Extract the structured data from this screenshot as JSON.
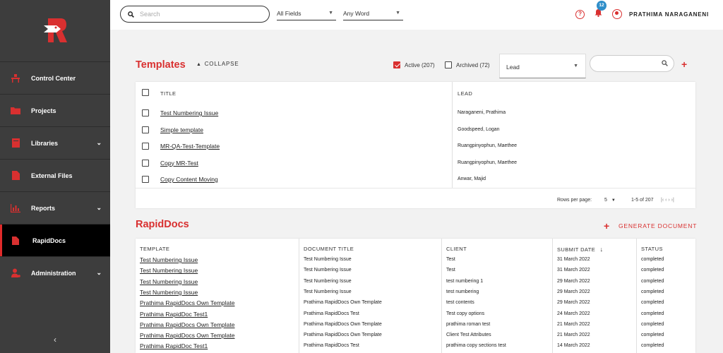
{
  "colors": {
    "accent": "#d93030",
    "sidebar": "#3d3d3d",
    "badge": "#2f8ec9"
  },
  "sidebar": {
    "items": [
      {
        "label": "Control Center",
        "icon": "desk-icon",
        "chevron": false,
        "active": false
      },
      {
        "label": "Projects",
        "icon": "folder-icon",
        "chevron": false,
        "active": false
      },
      {
        "label": "Libraries",
        "icon": "library-icon",
        "chevron": true,
        "active": false
      },
      {
        "label": "External Files",
        "icon": "file-icon",
        "chevron": false,
        "active": false
      },
      {
        "label": "Reports",
        "icon": "bar-chart-icon",
        "chevron": true,
        "active": false
      },
      {
        "label": "RapidDocs",
        "icon": "document-icon",
        "chevron": false,
        "active": true
      },
      {
        "label": "Administration",
        "icon": "admin-user-icon",
        "chevron": true,
        "active": false
      }
    ],
    "collapse_glyph": "‹"
  },
  "topbar": {
    "search_placeholder": "Search",
    "field_filter": "All Fields",
    "word_filter": "Any Word",
    "notification_count": "12",
    "user_name": "PRATHIMA NARAGANENI",
    "help_glyph": "?"
  },
  "templates": {
    "title": "Templates",
    "collapse_label": "COLLAPSE",
    "active_label": "Active (207)",
    "archived_label": "Archived (72)",
    "lead_select": "Lead",
    "add_glyph": "+",
    "columns": {
      "title": "TITLE",
      "lead": "LEAD"
    },
    "rows": [
      {
        "title": "Test Numbering Issue",
        "lead": "Naraganeni, Prathima"
      },
      {
        "title": "Simple template",
        "lead": "Goodspeed, Logan"
      },
      {
        "title": "MR-QA-Test-Template",
        "lead": "Ruangpinyophun, Maethee"
      },
      {
        "title": "Copy MR-Test",
        "lead": "Ruangpinyophun, Maethee"
      },
      {
        "title": "Copy Content Moving",
        "lead": "Anwar, Majid"
      }
    ],
    "pager": {
      "rows_per_page_label": "Rows per page:",
      "rows_per_page": "5",
      "range": "1-5 of 207",
      "nav_glyphs": "|‹  ‹  ›  ›|"
    }
  },
  "rapiddocs": {
    "title": "RapidDocs",
    "generate_label": "GENERATE DOCUMENT",
    "add_glyph": "+",
    "columns": {
      "template": "TEMPLATE",
      "document_title": "DOCUMENT TITLE",
      "client": "CLIENT",
      "submit_date": "SUBMIT DATE",
      "sort_glyph": "↓",
      "status": "STATUS"
    },
    "rows": [
      {
        "template": "Test Numbering Issue",
        "document_title": "Test Numbering Issue",
        "client": "Test",
        "submit_date": "31 March 2022",
        "status": "completed"
      },
      {
        "template": "Test Numbering Issue",
        "document_title": "Test Numbering Issue",
        "client": "Test",
        "submit_date": "31 March 2022",
        "status": "completed"
      },
      {
        "template": "Test Numbering Issue",
        "document_title": "Test Numbering Issue",
        "client": "test numbering 1",
        "submit_date": "29 March 2022",
        "status": "completed"
      },
      {
        "template": "Test Numbering Issue",
        "document_title": "Test Numbering Issue",
        "client": "test numbering",
        "submit_date": "29 March 2022",
        "status": "completed"
      },
      {
        "template": "Prathima RapidDocs Own Template",
        "document_title": "Prathima RapidDocs Own Template",
        "client": "test contents",
        "submit_date": "29 March 2022",
        "status": "completed"
      },
      {
        "template": "Prathima RapidDoc Test1",
        "document_title": "Prathima RapidDocs Test",
        "client": "Test copy options",
        "submit_date": "24 March 2022",
        "status": "completed"
      },
      {
        "template": "Prathima RapidDocs Own Template",
        "document_title": "Prathima RapidDocs Own Template",
        "client": "prathima roman test",
        "submit_date": "21 March 2022",
        "status": "completed"
      },
      {
        "template": "Prathima RapidDocs Own Template",
        "document_title": "Prathima RapidDocs Own Template",
        "client": "Client Test Attributes",
        "submit_date": "21 March 2022",
        "status": "completed"
      },
      {
        "template": "Prathima RapidDoc Test1",
        "document_title": "Prathima RapidDocs Test",
        "client": "prathima copy sections test",
        "submit_date": "14 March 2022",
        "status": "completed"
      }
    ]
  }
}
